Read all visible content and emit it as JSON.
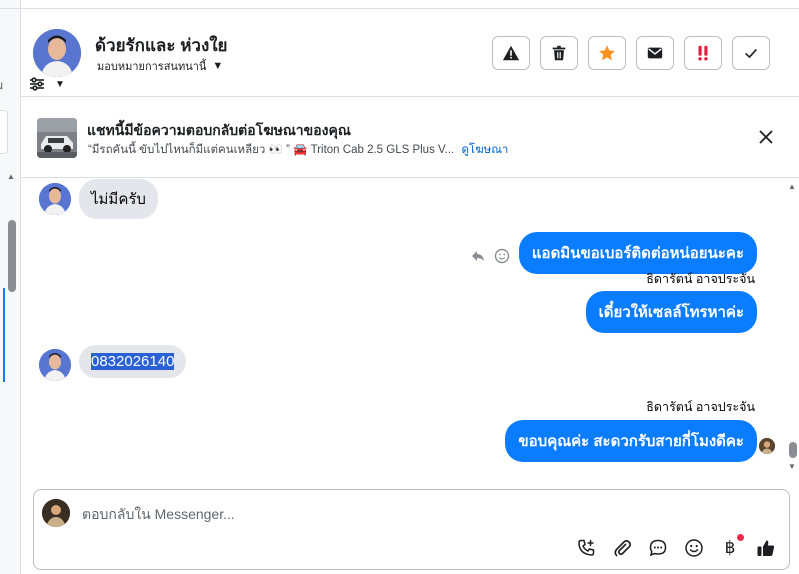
{
  "left_panel": {
    "fragment_text": "ม"
  },
  "header": {
    "contact_name": "ด้วยรักและ ห่วงใย",
    "assign_label": "มอบหมายการสนทนานี้",
    "actions": [
      {
        "name": "report-button",
        "icon": "warning-icon"
      },
      {
        "name": "delete-button",
        "icon": "trash-icon"
      },
      {
        "name": "star-button",
        "icon": "star-icon",
        "color": "#f7921e"
      },
      {
        "name": "mark-unread-button",
        "icon": "envelope-icon"
      },
      {
        "name": "follow-up-button",
        "icon": "double-exclamation-icon",
        "color": "#e41e3f"
      },
      {
        "name": "done-button",
        "icon": "check-icon"
      }
    ]
  },
  "ad_banner": {
    "title": "แชทนี้มีข้อความตอบกลับต่อโฆษณาของคุณ",
    "subtitle": "“มีรถคันนี้ ขับไปไหนก็มีแต่คนเหลียว 👀 ” 🚘 Triton Cab 2.5 GLS Plus V...",
    "link": "ดูโฆษณา"
  },
  "messages": [
    {
      "direction": "in",
      "text": "ไม่มีครับ"
    },
    {
      "direction": "out",
      "text": "แอดมินขอเบอร์ติดต่อหน่อยนะคะ"
    },
    {
      "direction": "out",
      "sender": "ธิดารัตน์ อาจประจัน",
      "text": "เดี๋ยวให้เซลล์โทรหาค่ะ"
    },
    {
      "direction": "in",
      "text": "0832026140",
      "selected": true
    },
    {
      "direction": "out",
      "sender": "ธิดารัตน์ อาจประจัน",
      "text": "ขอบคุณค่ะ สะดวกรับสายกี่โมงดีคะ"
    }
  ],
  "composer": {
    "placeholder": "ตอบกลับใน Messenger...",
    "tools": [
      "call-icon",
      "attachment-icon",
      "chat-bubble-icon",
      "emoji-icon",
      "baht-icon",
      "thumbs-up-icon"
    ],
    "baht_symbol": "฿"
  },
  "colors": {
    "accent": "#0a7cff",
    "incoming_bubble": "#e4e6eb",
    "notification": "#f02849"
  }
}
